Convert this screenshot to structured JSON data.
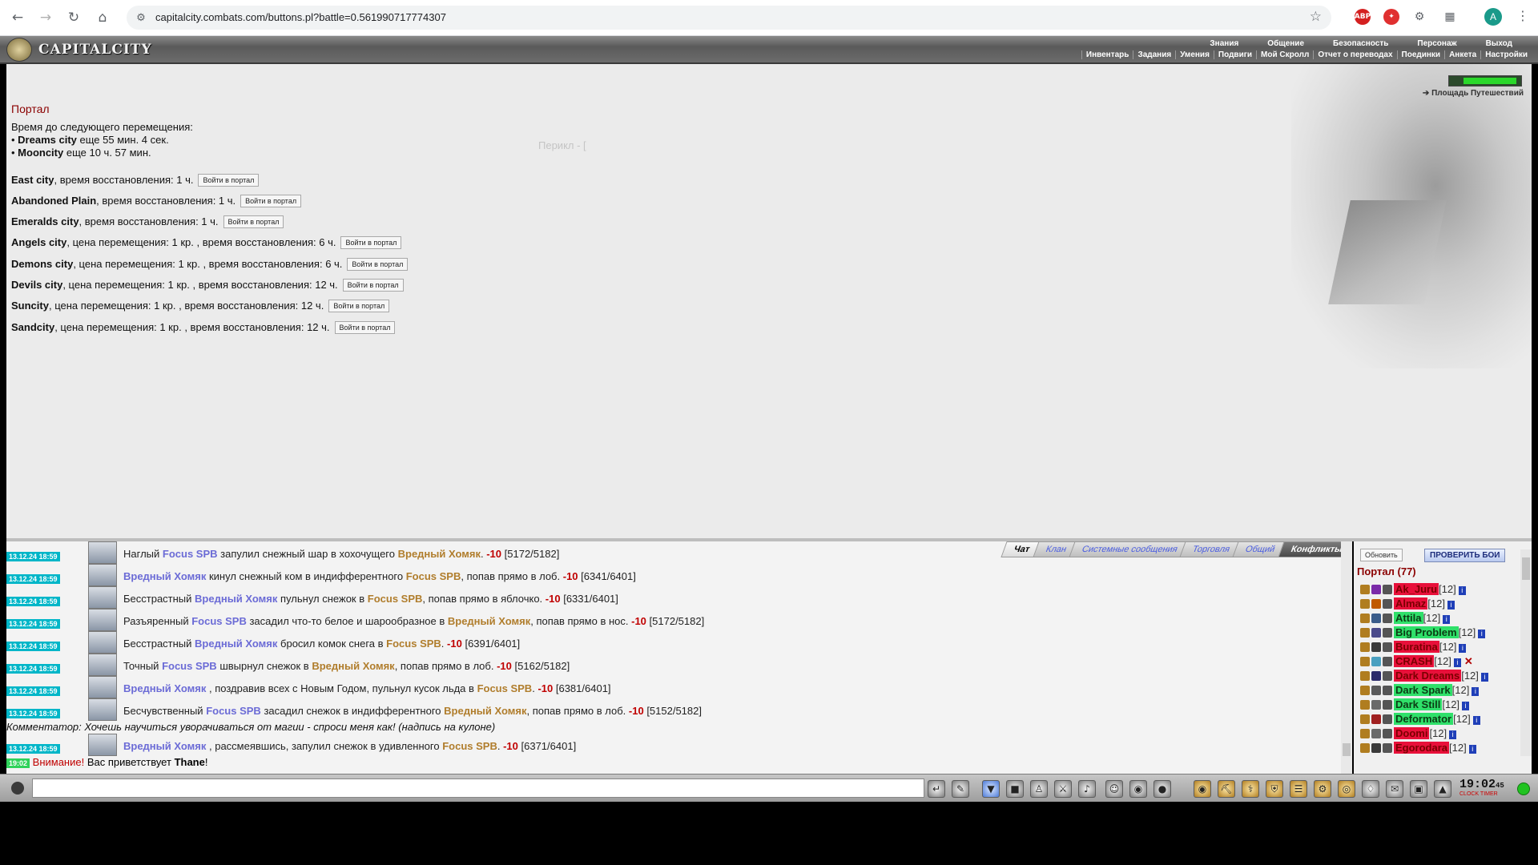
{
  "browser": {
    "url": "capitalcity.combats.com/buttons.pl?battle=0.561990717774307",
    "profile_initial": "A",
    "extensions": [
      "adblock",
      "ext-red",
      "ext-gray",
      "puzzle"
    ]
  },
  "header": {
    "logo_text": "CAPITALCITY",
    "top_menu": [
      "Знания",
      "Общение",
      "Безопасность",
      "Персонаж",
      "Выход"
    ],
    "sub_menu": [
      "Инвентарь",
      "Задания",
      "Умения",
      "Подвиги",
      "Мой Скролл",
      "Отчет о переводах",
      "Поединки",
      "Анкета",
      "Настройки"
    ]
  },
  "portal": {
    "title": "Портал",
    "next_move_label": "Время до следующего перемещения:",
    "next_moves": [
      {
        "city": "Dreams city",
        "time": "еще 55 мин. 4 сек."
      },
      {
        "city": "Mooncity",
        "time": "еще 10 ч. 57 мин."
      }
    ],
    "ghost_label": "Перикл - [",
    "enter_button": "Войти в портал",
    "destinations": [
      {
        "city": "East city",
        "info": ", время восстановления: 1 ч."
      },
      {
        "city": "Abandoned Plain",
        "info": ", время восстановления: 1 ч."
      },
      {
        "city": "Emeralds city",
        "info": ", время восстановления: 1 ч."
      },
      {
        "city": "Angels city",
        "info": ", цена перемещения: 1 кр. , время восстановления: 6 ч."
      },
      {
        "city": "Demons city",
        "info": ", цена перемещения: 1 кр. , время восстановления: 6 ч."
      },
      {
        "city": "Devils city",
        "info": ", цена перемещения: 1 кр. , время восстановления: 12 ч."
      },
      {
        "city": "Suncity",
        "info": ", цена перемещения: 1 кр. , время восстановления: 12 ч."
      },
      {
        "city": "Sandcity",
        "info": ", цена перемещения: 1 кр. , время восстановления: 12 ч."
      }
    ],
    "travel_link": "Площадь Путешествий"
  },
  "chat": {
    "tabs": [
      "Чат",
      "Клан",
      "Системные сообщения",
      "Торговля",
      "Общий",
      "Конфликты"
    ],
    "messages": [
      {
        "time": "13.12.24 18:59",
        "p1": "Наглый",
        "a": "Focus SPB",
        "p2": "запулил снежный шар в хохочущего",
        "b": "Вредный Хомяк",
        "p3": ".",
        "dmg": "-10",
        "hp": "[5172/5182]",
        "a_side": "b",
        "b_side": "o"
      },
      {
        "time": "13.12.24 18:59",
        "p1": "",
        "a": "Вредный Хомяк",
        "p2": "кинул снежный ком в индифферентного",
        "b": "Focus SPB",
        "p3": ", попав прямо в лоб.",
        "dmg": "-10",
        "hp": "[6341/6401]",
        "a_side": "b",
        "b_side": "o"
      },
      {
        "time": "13.12.24 18:59",
        "p1": "Бесстрастный",
        "a": "Вредный Хомяк",
        "p2": "пульнул снежок в",
        "b": "Focus SPB",
        "p3": ", попав прямо в яблочко.",
        "dmg": "-10",
        "hp": "[6331/6401]",
        "a_side": "b",
        "b_side": "o"
      },
      {
        "time": "13.12.24 18:59",
        "p1": "Разъяренный",
        "a": "Focus SPB",
        "p2": "засадил что-то белое и шарообразное в",
        "b": "Вредный Хомяк",
        "p3": ", попав прямо в нос.",
        "dmg": "-10",
        "hp": "[5172/5182]",
        "a_side": "b",
        "b_side": "o"
      },
      {
        "time": "13.12.24 18:59",
        "p1": "Бесстрастный",
        "a": "Вредный Хомяк",
        "p2": "бросил комок снега в",
        "b": "Focus SPB",
        "p3": ".",
        "dmg": "-10",
        "hp": "[6391/6401]",
        "a_side": "b",
        "b_side": "o"
      },
      {
        "time": "13.12.24 18:59",
        "p1": "Точный",
        "a": "Focus SPB",
        "p2": "швырнул снежок в",
        "b": "Вредный Хомяк",
        "p3": ", попав прямо в лоб.",
        "dmg": "-10",
        "hp": "[5162/5182]",
        "a_side": "b",
        "b_side": "o"
      },
      {
        "time": "13.12.24 18:59",
        "p1": "",
        "a": "Вредный Хомяк",
        "p2": ", поздравив всех с Новым Годом, пульнул кусок льда в",
        "b": "Focus SPB",
        "p3": ".",
        "dmg": "-10",
        "hp": "[6381/6401]",
        "a_side": "b",
        "b_side": "o"
      },
      {
        "time": "13.12.24 18:59",
        "p1": "Бесчувственный",
        "a": "Focus SPB",
        "p2": "засадил снежок в индифферентного",
        "b": "Вредный Хомяк",
        "p3": ", попав прямо в лоб.",
        "dmg": "-10",
        "hp": "[5152/5182]",
        "a_side": "b",
        "b_side": "o"
      },
      {
        "time": "13.12.24 18:59",
        "p1": "",
        "a": "Вредный Хомяк",
        "p2": ", рассмеявшись, запулил снежок в удивленного",
        "b": "Focus SPB",
        "p3": ".",
        "dmg": "-10",
        "hp": "[6371/6401]",
        "a_side": "b",
        "b_side": "o"
      }
    ],
    "commentator": "Комментатор: Хочешь научиться уворачиваться от магии - спроси меня как! (надпись на кулоне)",
    "notice_time": "19:02",
    "notice_warning": "Внимание!",
    "notice_text": "Вас приветствует",
    "notice_name": "Thane",
    "notice_end": "!"
  },
  "online": {
    "refresh": "Обновить",
    "check_battles": "ПРОВЕРИТЬ БОИ",
    "room": "Портал (77)",
    "players": [
      {
        "name": "Ak_Juru",
        "level": "[12]",
        "bg": "#e8103a",
        "fg": "#7a0000",
        "icon": "#7a2aa8",
        "x": false
      },
      {
        "name": "Almaz",
        "level": "[12]",
        "bg": "#e8103a",
        "fg": "#7a0000",
        "icon": "#c05a00",
        "x": false
      },
      {
        "name": "Attila",
        "level": "[12]",
        "bg": "#2fe06a",
        "fg": "#0b3b14",
        "icon": "#3a5c8a",
        "x": false
      },
      {
        "name": "Big Problem",
        "level": "[12]",
        "bg": "#2fe06a",
        "fg": "#0b3b14",
        "icon": "#4a4a8a",
        "x": false
      },
      {
        "name": "Buratina",
        "level": "[12]",
        "bg": "#e8103a",
        "fg": "#7a0000",
        "icon": "#3a3a3a",
        "x": false
      },
      {
        "name": "CRASH",
        "level": "[12]",
        "bg": "#e8103a",
        "fg": "#7a0000",
        "icon": "#4aa0c0",
        "x": true
      },
      {
        "name": "Dark Dreams",
        "level": "[12]",
        "bg": "#e8103a",
        "fg": "#7a0000",
        "icon": "#2a2a6a",
        "x": false
      },
      {
        "name": "Dark Spark",
        "level": "[12]",
        "bg": "#2fe06a",
        "fg": "#0b3b14",
        "icon": "#5a5a5a",
        "x": false
      },
      {
        "name": "Dark Still",
        "level": "[12]",
        "bg": "#2fe06a",
        "fg": "#0b3b14",
        "icon": "#6a6a6a",
        "x": false
      },
      {
        "name": "Deformator",
        "level": "[12]",
        "bg": "#2fe06a",
        "fg": "#0b3b14",
        "icon": "#a02020",
        "x": false
      },
      {
        "name": "Doomi",
        "level": "[12]",
        "bg": "#e8103a",
        "fg": "#7a0000",
        "icon": "#6a6a6a",
        "x": false
      },
      {
        "name": "Egorodara",
        "level": "[12]",
        "bg": "#e8103a",
        "fg": "#7a0000",
        "icon": "#3a3a3a",
        "x": false
      }
    ]
  },
  "toolbar": {
    "clock": "19:02",
    "clock_seconds": "45",
    "clock_labels": "CLOCK TIMER"
  },
  "colors": {
    "portal_title": "#8b0000",
    "timestamp_bg": "#00b6c8",
    "attacker_blue": "#6b6bd6",
    "target_gold": "#b07d2c",
    "damage_red": "#c00000"
  }
}
